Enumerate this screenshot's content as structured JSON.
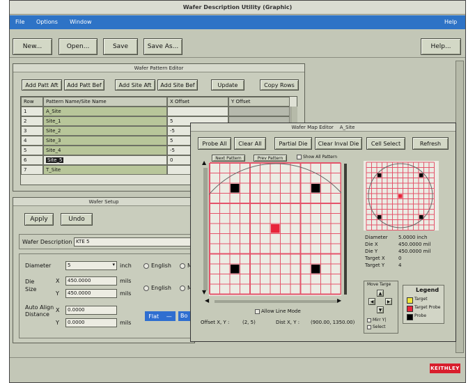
{
  "window": {
    "title": "Wafer Description Utility (Graphic)"
  },
  "menu": {
    "file": "File",
    "options": "Options",
    "window": "Window",
    "help": "Help"
  },
  "toolbar": {
    "new": "New...",
    "open": "Open...",
    "save": "Save",
    "save_as": "Save As...",
    "help": "Help..."
  },
  "pattern_editor": {
    "title": "Wafer Pattern Editor",
    "buttons": {
      "add_patt_aft": "Add Patt Aft",
      "add_patt_bef": "Add Patt Bef",
      "add_site_aft": "Add Site Aft",
      "add_site_bef": "Add Site Bef",
      "update": "Update",
      "copy_rows": "Copy Rows"
    },
    "columns": [
      "Row",
      "Pattern Name/Site Name",
      "X Offset",
      "Y Offset"
    ],
    "rows": [
      {
        "row": "1",
        "name": "A_Site",
        "x": "",
        "y": ""
      },
      {
        "row": "2",
        "name": "Site_1",
        "x": "5",
        "y": ""
      },
      {
        "row": "3",
        "name": "Site_2",
        "x": "-5",
        "y": ""
      },
      {
        "row": "4",
        "name": "Site_3",
        "x": "5",
        "y": ""
      },
      {
        "row": "5",
        "name": "Site_4",
        "x": "-5",
        "y": ""
      },
      {
        "row": "6",
        "name": "Site_5",
        "x": "0",
        "y": ""
      },
      {
        "row": "7",
        "name": "T_Site",
        "x": "",
        "y": ""
      }
    ]
  },
  "wafer_setup": {
    "title": "Wafer Setup",
    "apply": "Apply",
    "undo": "Undo",
    "description_label": "Wafer Description",
    "description_value": "KTE 5",
    "diameter_label": "Diameter",
    "diameter_value": "5",
    "diameter_unit": "inch",
    "die_size_label": "Die Size",
    "die_x_label": "X",
    "die_x_value": "450.0000",
    "die_y_label": "Y",
    "die_y_value": "450.0000",
    "die_unit": "mils",
    "auto_align_label": "Auto Align Distance",
    "align_x_label": "X",
    "align_x_value": "0.0000",
    "align_y_label": "Y",
    "align_y_value": "0.0000",
    "align_unit": "mils",
    "english_1": "English",
    "english_2": "English",
    "metric_1": "M",
    "metric_2": "M",
    "flat_label": "Flat",
    "flat_dash": "—",
    "bottom_label": "Bo"
  },
  "map_editor": {
    "title": "Wafer Map Editor    A_Site",
    "buttons": {
      "probe_all": "Probe All",
      "clear_all": "Clear All",
      "partial_die": "Partial Die",
      "clear_inval_die": "Clear Inval Die",
      "cell_select": "Cell Select",
      "refresh": "Refresh"
    },
    "next_pattern": "Next Pattern",
    "prev_pattern": "Prev Pattern",
    "show_all_pattern": "Show All Pattern",
    "allow_line_mode": "Allow Line Mode",
    "offset_label": "Offset X, Y :",
    "offset_value": "(2, 5)",
    "dist_label": "Dist X, Y :",
    "dist_value": "(900.00, 1350.00)",
    "info": [
      {
        "label": "Diameter",
        "value": "5.0000 inch"
      },
      {
        "label": "Die X",
        "value": "450.0000 mil"
      },
      {
        "label": "Die Y",
        "value": "450.0000 mil"
      },
      {
        "label": "Target X",
        "value": "0"
      },
      {
        "label": "Target Y",
        "value": "4"
      }
    ],
    "move_target": "Move Targe",
    "mirror_label": "Mirr Y|",
    "select_label": "Select",
    "legend": {
      "title": "Legend",
      "target": "Target",
      "target_probe": "Target Probe",
      "probe": "Probe"
    },
    "colors": {
      "probe": "#000000",
      "target_probe": "#e8253a",
      "target": "#f0e63c",
      "grid": "#e4536a"
    }
  },
  "brand": {
    "logo": "KEITHLEY",
    "color": "#d81e2c"
  }
}
